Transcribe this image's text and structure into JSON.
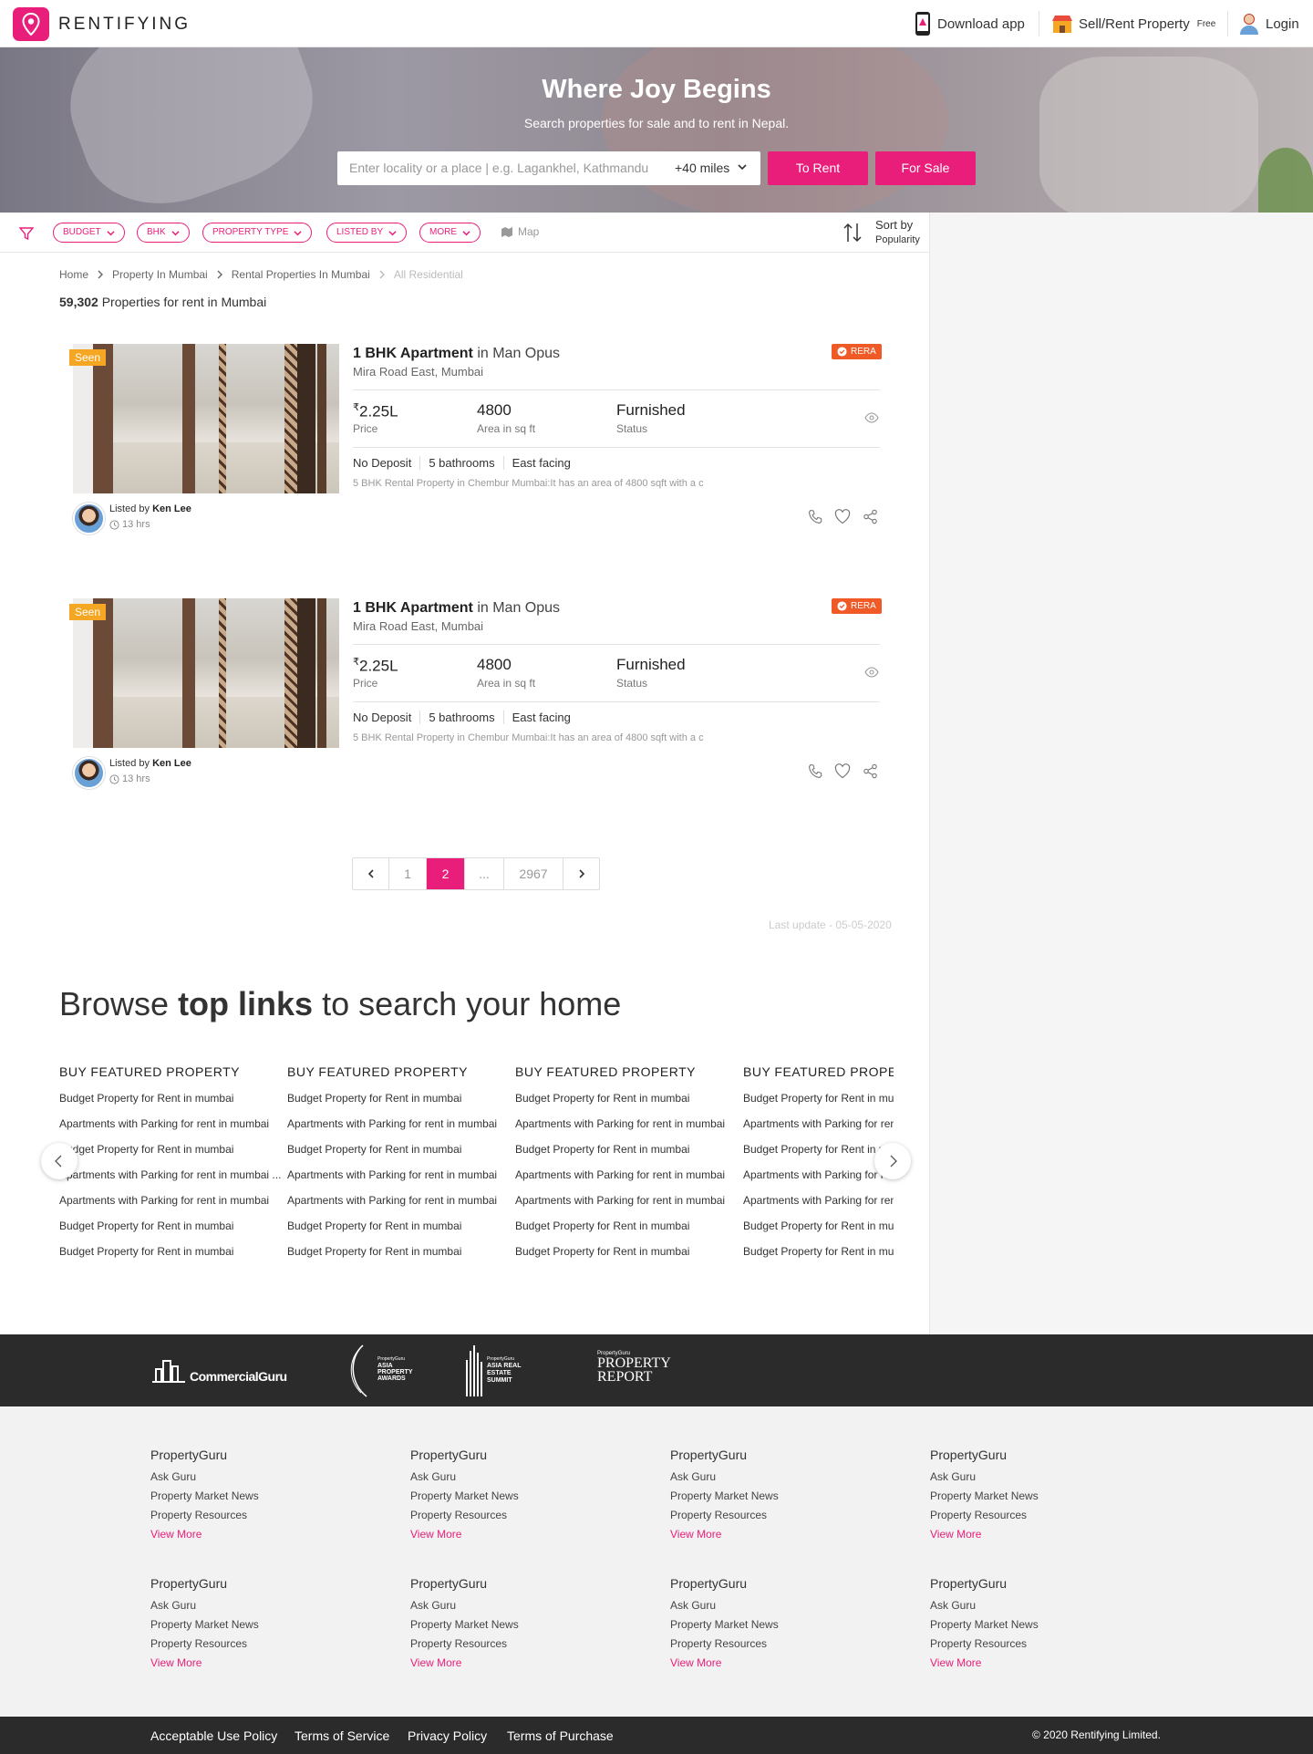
{
  "header": {
    "brand": "RENTIFYING",
    "download_app": "Download app",
    "sell_rent": "Sell/Rent Property",
    "free": "Free",
    "login": "Login"
  },
  "hero": {
    "title": "Where Joy Begins",
    "subtitle": "Search properties for sale and to rent in Nepal.",
    "search_placeholder": "Enter locality or a place | e.g. Lagankhel, Kathmandu",
    "radius": "+40 miles",
    "to_rent": "To Rent",
    "for_sale": "For Sale"
  },
  "filters": {
    "chips": [
      "BUDGET",
      "BHK",
      "PROPERTY TYPE",
      "LISTED BY",
      "MORE"
    ],
    "map": "Map",
    "sort_label": "Sort by",
    "sort_value": "Popularity"
  },
  "breadcrumb": [
    "Home",
    "Property In Mumbai",
    "Rental Properties In Mumbai",
    "All Residential"
  ],
  "results": {
    "count": "59,302",
    "text": "Properties for rent in Mumbai"
  },
  "listings": [
    {
      "seen": "Seen",
      "title_bold": "1 BHK Apartment",
      "title_rest": "in Man Opus",
      "location": "Mira Road East, Mumbai",
      "rera": "RERA",
      "currency": "₹",
      "price": "2.25L",
      "price_label": "Price",
      "area": "4800",
      "area_label": "Area in sq ft",
      "status": "Furnished",
      "status_label": "Status",
      "features": [
        "No Deposit",
        "5 bathrooms",
        "East facing"
      ],
      "description": "5 BHK Rental Property in Chembur Mumbai:It has an area of 4800 sqft with a c",
      "listed_by_prefix": "Listed by",
      "agent": "Ken Lee",
      "time": "13 hrs"
    },
    {
      "seen": "Seen",
      "title_bold": "1 BHK Apartment",
      "title_rest": "in Man Opus",
      "location": "Mira Road East, Mumbai",
      "rera": "RERA",
      "currency": "₹",
      "price": "2.25L",
      "price_label": "Price",
      "area": "4800",
      "area_label": "Area in sq ft",
      "status": "Furnished",
      "status_label": "Status",
      "features": [
        "No Deposit",
        "5 bathrooms",
        "East facing"
      ],
      "description": "5 BHK Rental Property in Chembur Mumbai:It has an area of 4800 sqft with a c",
      "listed_by_prefix": "Listed by",
      "agent": "Ken Lee",
      "time": "13 hrs"
    }
  ],
  "pagination": {
    "pages": [
      "1",
      "2",
      "...",
      "2967"
    ],
    "current": "2"
  },
  "last_update": "Last update - 05-05-2020",
  "browse": {
    "pre": "Browse",
    "bold": "top links",
    "post": "to search your home",
    "columns": [
      {
        "heading": "BUY FEATURED PROPERTY",
        "links": [
          "Budget Property for Rent in mumbai",
          "Apartments with Parking for rent in mumbai",
          "Budget Property for Rent in mumbai",
          "Apartments with Parking for rent in mumbai ...",
          "Apartments with Parking for rent in mumbai",
          "Budget Property for Rent in mumbai",
          "Budget Property for Rent in mumbai"
        ]
      },
      {
        "heading": "BUY FEATURED PROPERTY",
        "links": [
          "Budget Property for Rent in mumbai",
          "Apartments with Parking for rent in mumbai",
          "Budget Property for Rent in mumbai",
          "Apartments with Parking for rent in mumbai",
          "Apartments with Parking for rent in mumbai",
          "Budget Property for Rent in mumbai",
          "Budget Property for Rent in mumbai"
        ]
      },
      {
        "heading": "BUY FEATURED PROPERTY",
        "links": [
          "Budget Property for Rent in mumbai",
          "Apartments with Parking for rent in mumbai",
          "Budget Property for Rent in mumbai",
          "Apartments with Parking for rent in mumbai",
          "Apartments with Parking for rent in mumbai",
          "Budget Property for Rent in mumbai",
          "Budget Property for Rent in mumbai"
        ]
      },
      {
        "heading": "BUY FEATURED PROPERTY",
        "links": [
          "Budget Property for Rent in mumbai",
          "Apartments with Parking for rent in mumbai",
          "Budget Property for Rent in mumbai",
          "Apartments with Parking for rent in mumbai",
          "Apartments with Parking for rent in mumbai",
          "Budget Property for Rent in mumbai",
          "Budget Property for Rent in mumbai"
        ]
      }
    ]
  },
  "partner_logos": {
    "commercial": "CommercialGuru",
    "awards_top": "PropertyGuru",
    "awards_main": "ASIA PROPERTY AWARDS",
    "summit_top": "PropertyGuru",
    "summit_main": "ASIA REAL ESTATE SUMMIT",
    "report_top": "PropertyGuru",
    "report_main": "PROPERTY REPORT"
  },
  "footer_columns": [
    {
      "title": "PropertyGuru",
      "links": [
        "Ask Guru",
        "Property Market News",
        "Property Resources"
      ],
      "more": "View More"
    },
    {
      "title": "PropertyGuru",
      "links": [
        "Ask Guru",
        "Property Market News",
        "Property Resources"
      ],
      "more": "View More"
    },
    {
      "title": "PropertyGuru",
      "links": [
        "Ask Guru",
        "Property Market News",
        "Property Resources"
      ],
      "more": "View More"
    },
    {
      "title": "PropertyGuru",
      "links": [
        "Ask Guru",
        "Property Market News",
        "Property Resources"
      ],
      "more": "View More"
    },
    {
      "title": "PropertyGuru",
      "links": [
        "Ask Guru",
        "Property Market News",
        "Property Resources"
      ],
      "more": "View More"
    },
    {
      "title": "PropertyGuru",
      "links": [
        "Ask Guru",
        "Property Market News",
        "Property Resources"
      ],
      "more": "View More"
    },
    {
      "title": "PropertyGuru",
      "links": [
        "Ask Guru",
        "Property Market News",
        "Property Resources"
      ],
      "more": "View More"
    },
    {
      "title": "PropertyGuru",
      "links": [
        "Ask Guru",
        "Property Market News",
        "Property Resources"
      ],
      "more": "View More"
    }
  ],
  "footer_links": [
    "Acceptable Use Policy",
    "Terms of Service",
    "Privacy Policy",
    "Terms of Purchase"
  ],
  "copyright": "© 2020 Rentifying Limited.",
  "colors": {
    "accent": "#e91e7a",
    "seen": "#f5a623",
    "rera": "#ef5a27",
    "footer_dark": "#2b2b2b"
  }
}
